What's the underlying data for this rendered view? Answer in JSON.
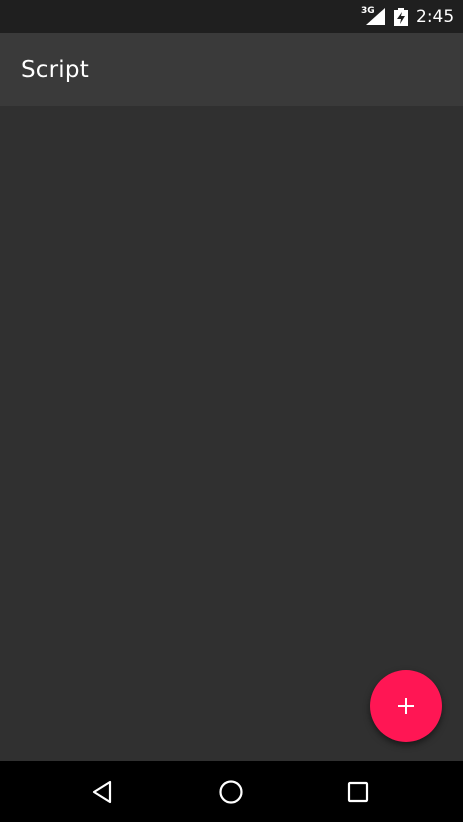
{
  "status_bar": {
    "network_type": "3G",
    "signal_icon": "signal-icon",
    "battery_icon": "battery-charging-icon",
    "time": "2:45"
  },
  "toolbar": {
    "title": "Script"
  },
  "fab": {
    "icon": "plus-icon",
    "color": "#ff1654"
  },
  "nav_bar": {
    "back_icon": "back-icon",
    "home_icon": "home-icon",
    "recents_icon": "recents-icon"
  },
  "colors": {
    "status_bar": "#1f1f1f",
    "toolbar": "#3a3a3a",
    "background": "#303030",
    "nav_bar": "#000000"
  }
}
